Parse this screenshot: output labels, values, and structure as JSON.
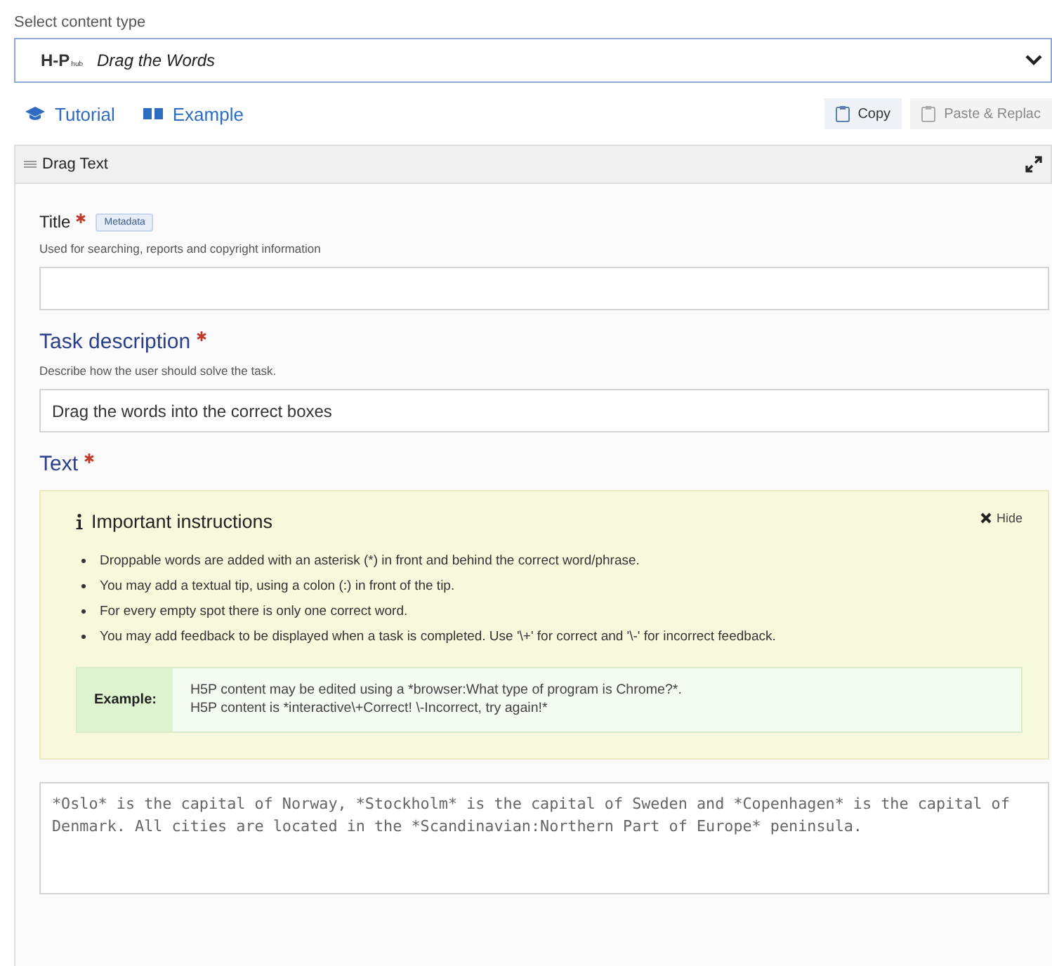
{
  "content_type": {
    "label": "Select content type",
    "logo": {
      "main": "H-P",
      "sub": "hub"
    },
    "value": "Drag the Words"
  },
  "links": [
    {
      "label": "Tutorial",
      "kind": "tutorial"
    },
    {
      "label": "Example",
      "kind": "example"
    }
  ],
  "actions": [
    {
      "label": "Copy",
      "disabled": false
    },
    {
      "label": "Paste & Replac",
      "disabled": true
    }
  ],
  "section": {
    "title": "Drag Text"
  },
  "fields": [
    {
      "kind": "input",
      "label": "Title",
      "required": true,
      "badge": "Metadata",
      "description": "Used for searching, reports and copyright information"
    },
    {
      "kind": "input",
      "label": "Task description",
      "required": true,
      "description": "Describe how the user should solve the task.",
      "value": "Drag the words into the correct boxes"
    },
    {
      "kind": "textarea",
      "label": "Text",
      "required": true,
      "instructions": {
        "title": "Important instructions",
        "hide": "Hide",
        "items": [
          "Droppable words are added with an asterisk (*) in front and behind the correct word/phrase.",
          "You may add a textual tip, using a colon (:) in front of the tip.",
          "For every empty spot there is only one correct word.",
          "You may add feedback to be displayed when a task is completed. Use '\\+' for correct and '\\-' for incorrect feedback."
        ],
        "example_label": "Example:",
        "example_lines": [
          "H5P content may be edited using a *browser:What type of program is Chrome?*.",
          "H5P content is *interactive\\+Correct! \\-Incorrect, try again!*"
        ]
      },
      "value": "*Oslo* is the capital of Norway, *Stockholm* is the capital of Sweden and *Copenhagen* is the capital of Denmark. All cities are located in the *Scandinavian:Northern Part of Europe* peninsula."
    }
  ]
}
